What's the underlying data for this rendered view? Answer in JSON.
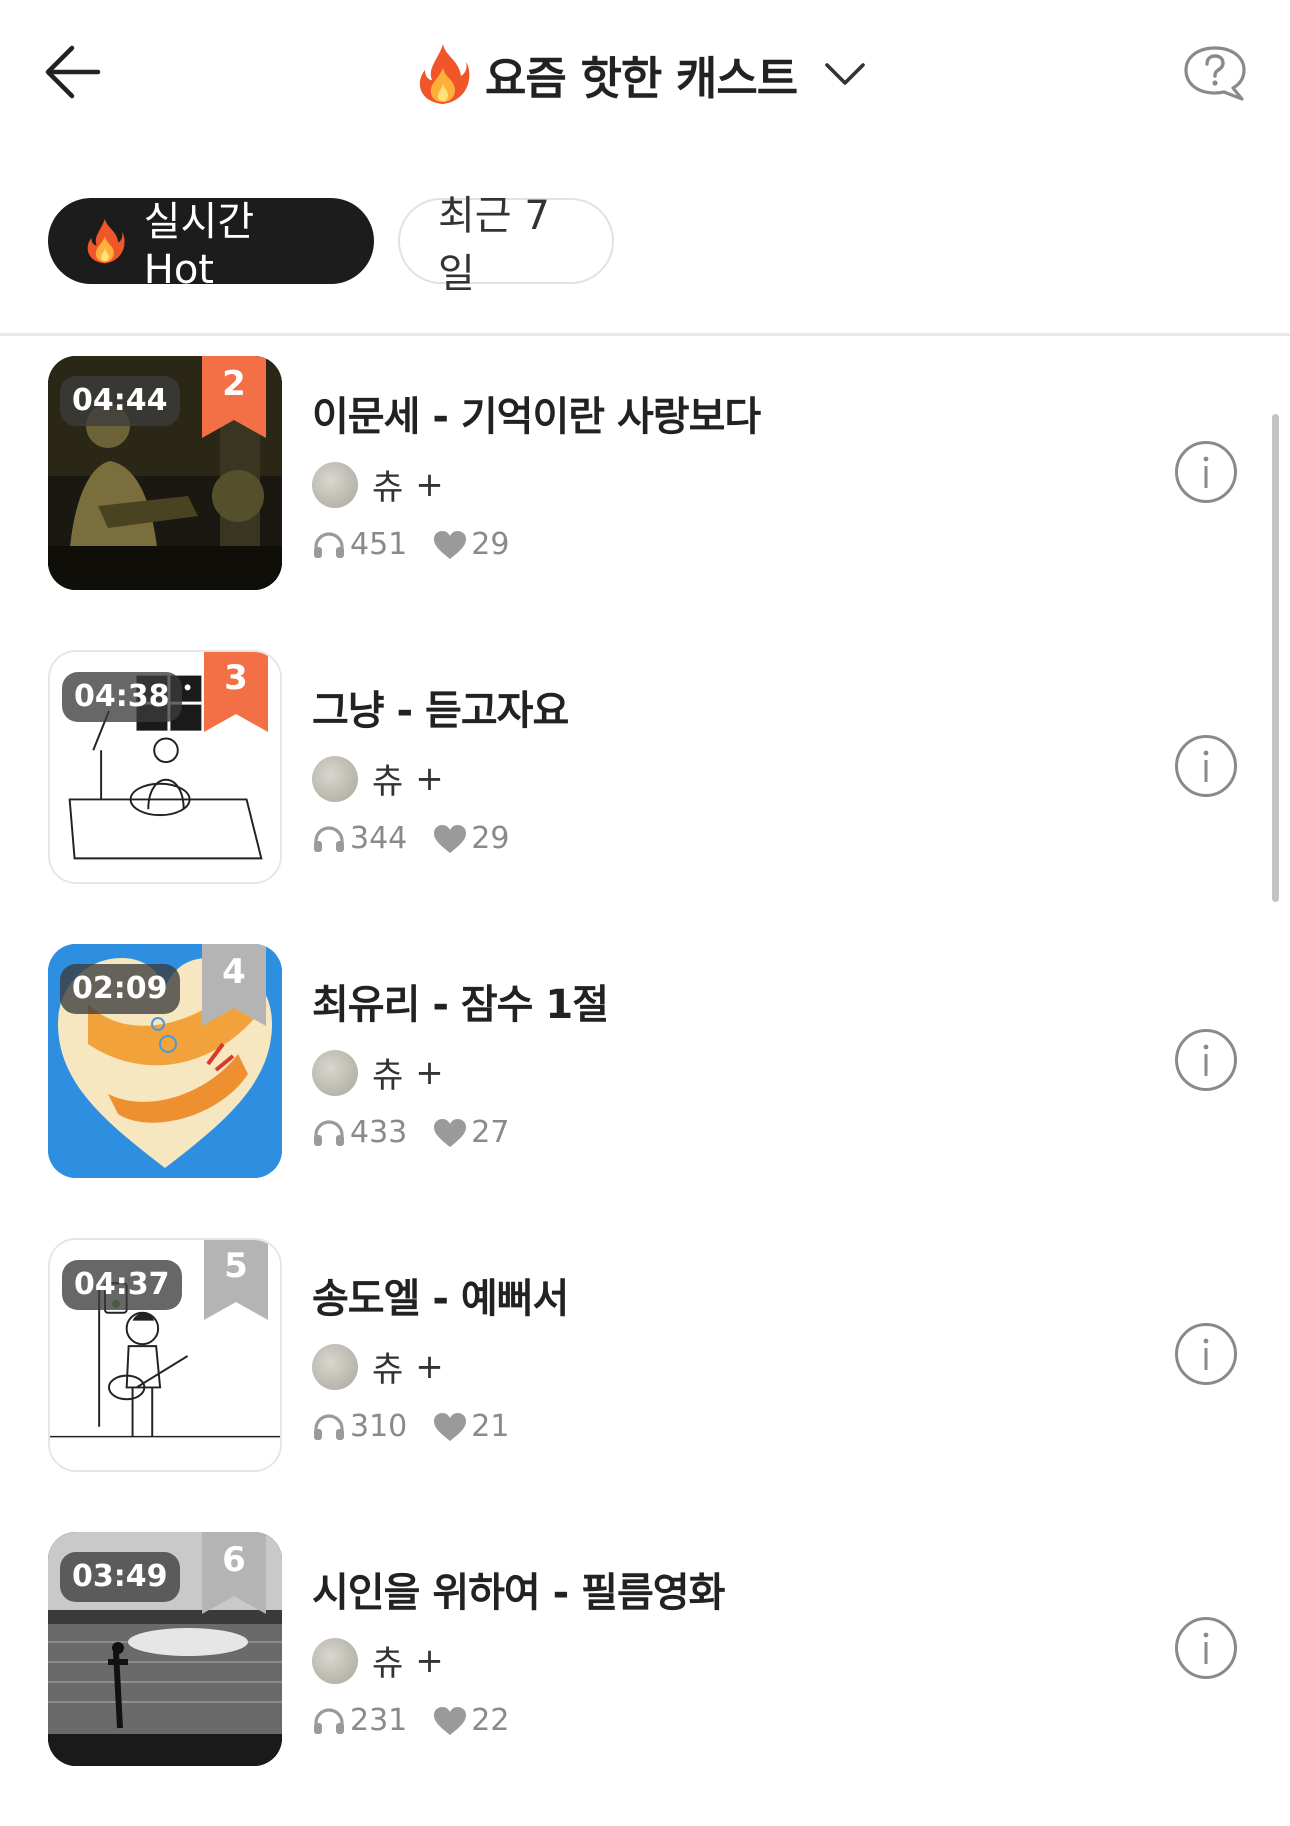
{
  "header": {
    "title": "요즘 핫한 캐스트",
    "back_icon": "arrow-left-icon",
    "help_icon": "question-bubble-icon"
  },
  "tabs": [
    {
      "label": "실시간 Hot",
      "active": true
    },
    {
      "label": "최근 7일",
      "active": false
    }
  ],
  "colors": {
    "accent": "#f36f45",
    "rank_gray": "#b4b4b4",
    "tab_active_bg": "#1c1c1c",
    "muted_text": "#8a8a8a"
  },
  "casts": [
    {
      "rank": "2",
      "duration": "04:44",
      "title": "이문세 - 기억이란 사랑보다",
      "author": "츄",
      "follow": "+",
      "plays": "451",
      "likes": "29",
      "rank_highlight": true
    },
    {
      "rank": "3",
      "duration": "04:38",
      "title": "그냥 - 듣고자요",
      "author": "츄",
      "follow": "+",
      "plays": "344",
      "likes": "29",
      "rank_highlight": true
    },
    {
      "rank": "4",
      "duration": "02:09",
      "title": "최유리 - 잠수 1절",
      "author": "츄",
      "follow": "+",
      "plays": "433",
      "likes": "27",
      "rank_highlight": false
    },
    {
      "rank": "5",
      "duration": "04:37",
      "title": "송도엘 - 예뻐서",
      "author": "츄",
      "follow": "+",
      "plays": "310",
      "likes": "21",
      "rank_highlight": false
    },
    {
      "rank": "6",
      "duration": "03:49",
      "title": "시인을 위하여 - 필름영화",
      "author": "츄",
      "follow": "+",
      "plays": "231",
      "likes": "22",
      "rank_highlight": false
    }
  ]
}
